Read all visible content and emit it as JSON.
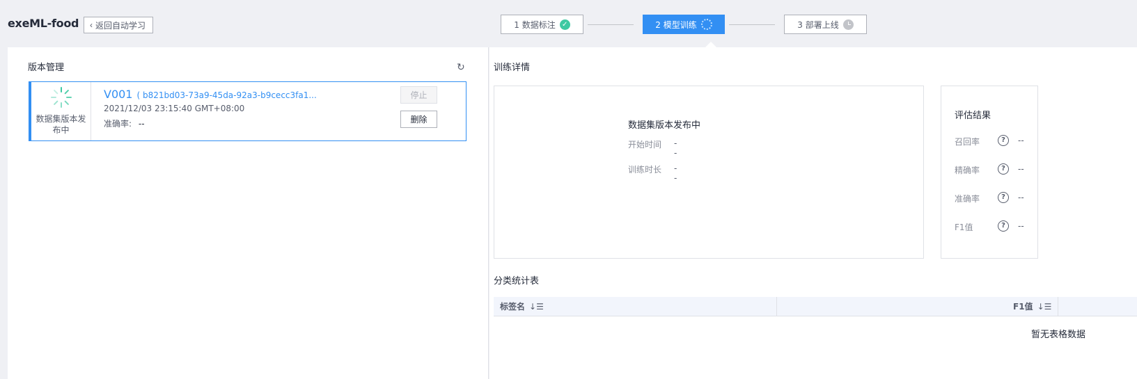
{
  "header": {
    "app_title": "exeML-food",
    "back_label": "返回自动学习"
  },
  "steps": [
    {
      "label": "1 数据标注",
      "state": "done"
    },
    {
      "label": "2 模型训练",
      "state": "active"
    },
    {
      "label": "3 部署上线",
      "state": "pending"
    }
  ],
  "version_panel": {
    "title": "版本管理",
    "card": {
      "status_text": "数据集版本发布中",
      "version": "V001",
      "version_id": "( b821bd03-73a9-45da-92a3-b9cecc3fa1...",
      "date": "2021/12/03 23:15:40 GMT+08:00",
      "accuracy_label": "准确率:",
      "accuracy_value": "--",
      "stop_label": "停止",
      "delete_label": "删除"
    }
  },
  "training_detail": {
    "title": "训练详情",
    "status": "数据集版本发布中",
    "start_time_label": "开始时间",
    "start_time_value": "--",
    "duration_label": "训练时长",
    "duration_value": "--"
  },
  "evaluation": {
    "title": "评估结果",
    "rows": [
      {
        "label": "召回率",
        "value": "--"
      },
      {
        "label": "精确率",
        "value": "--"
      },
      {
        "label": "准确率",
        "value": "--"
      },
      {
        "label": "F1值",
        "value": "--"
      }
    ]
  },
  "classification_table": {
    "title": "分类统计表",
    "columns": [
      "标签名",
      "F1值"
    ],
    "empty_text": "暂无表格数据"
  },
  "colors": {
    "accent": "#328ff3",
    "success": "#3ec9a2"
  }
}
